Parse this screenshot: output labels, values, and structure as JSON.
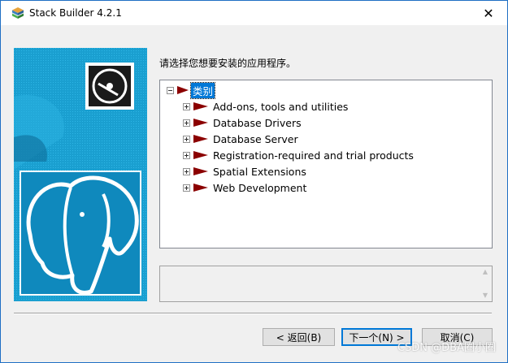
{
  "window": {
    "title": "Stack Builder 4.2.1",
    "close_glyph": "✕"
  },
  "instruction": "请选择您想要安装的应用程序。",
  "tree": {
    "root": {
      "label": "类别",
      "expander": "minus"
    },
    "items": [
      {
        "label": "Add-ons, tools and utilities",
        "expander": "plus"
      },
      {
        "label": "Database Drivers",
        "expander": "plus"
      },
      {
        "label": "Database Server",
        "expander": "plus"
      },
      {
        "label": "Registration-required and trial products",
        "expander": "plus"
      },
      {
        "label": "Spatial Extensions",
        "expander": "plus"
      },
      {
        "label": "Web Development",
        "expander": "plus"
      }
    ]
  },
  "description": "",
  "buttons": {
    "back": "< 返回(B)",
    "next": "下一个(N) >",
    "cancel": "取消(C)"
  },
  "watermark": "CSDN @DBA圈小圈",
  "colors": {
    "accent": "#0078d7",
    "flag": "#8b0000",
    "side_blue": "#1a9fd0"
  },
  "icons": {
    "app": "stack-builder-icon",
    "close": "close-icon",
    "cd": "cd-disc-icon",
    "elephant": "postgresql-elephant-logo",
    "flag": "red-flag-icon"
  }
}
